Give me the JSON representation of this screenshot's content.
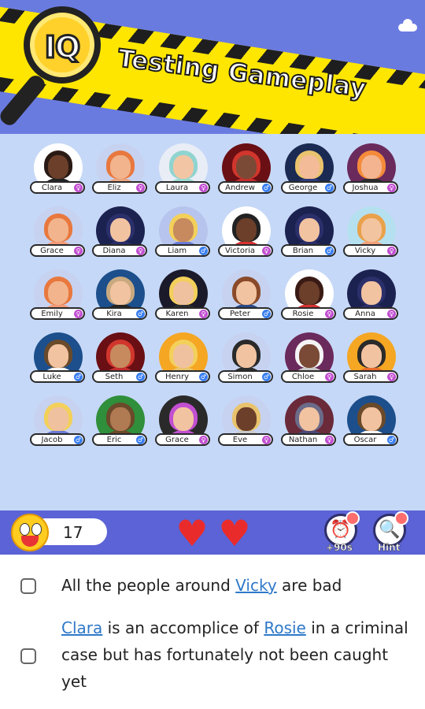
{
  "banner": {
    "logo_text": "IQ",
    "title": "Testing Gameplay"
  },
  "characters": [
    {
      "name": "Clara",
      "gender": "female",
      "hair": "#2a1a14",
      "skin": "#6b3f2a",
      "shirt": "#222",
      "bg": "#ffffff"
    },
    {
      "name": "Eliz",
      "gender": "female",
      "hair": "#e8783e",
      "skin": "#f2b48c",
      "shirt": "#e9a37f",
      "bg": "#c6d2f0"
    },
    {
      "name": "Laura",
      "gender": "female",
      "hair": "#8fd4d0",
      "skin": "#f2c6a4",
      "shirt": "#9ad9d2",
      "bg": "#e9edf5"
    },
    {
      "name": "Andrew",
      "gender": "male",
      "hair": "#d1362c",
      "skin": "#7a4a36",
      "shirt": "#c52e2e",
      "bg": "#6a0f14"
    },
    {
      "name": "George",
      "gender": "male",
      "hair": "#e9c36d",
      "skin": "#f4bb98",
      "shirt": "#2e3a7a",
      "bg": "#1a2a52"
    },
    {
      "name": "Joshua",
      "gender": "female",
      "hair": "#f48b3a",
      "skin": "#f3b48f",
      "shirt": "#2c2c2c",
      "bg": "#6b2a5c"
    },
    {
      "name": "Grace",
      "gender": "female",
      "hair": "#e8783e",
      "skin": "#f2b48c",
      "shirt": "#f39a7a",
      "bg": "#c6d2f0"
    },
    {
      "name": "Diana",
      "gender": "female",
      "hair": "#2b2f6a",
      "skin": "#f2c3a0",
      "shirt": "#2b2f6a",
      "bg": "#1c2250"
    },
    {
      "name": "Liam",
      "gender": "male",
      "hair": "#f3d05a",
      "skin": "#c68a5e",
      "shirt": "#6a7bd6",
      "bg": "#b7c4ee"
    },
    {
      "name": "Victoria",
      "gender": "female",
      "hair": "#222",
      "skin": "#6b3f2a",
      "shirt": "#d83131",
      "bg": "#ffffff"
    },
    {
      "name": "Brian",
      "gender": "male",
      "hair": "#2b2f6a",
      "skin": "#f2c3a0",
      "shirt": "#2b2f6a",
      "bg": "#1c2250"
    },
    {
      "name": "Vicky",
      "gender": "female",
      "hair": "#e9a24b",
      "skin": "#f3c4a0",
      "shirt": "#f3a07a",
      "bg": "#b5e0ef"
    },
    {
      "name": "Emily",
      "gender": "female",
      "hair": "#e8783e",
      "skin": "#f2b48c",
      "shirt": "#f39a7a",
      "bg": "#c6d2f0"
    },
    {
      "name": "Kira",
      "gender": "male",
      "hair": "#c9a97f",
      "skin": "#f2c3a0",
      "shirt": "#222",
      "bg": "#1c4f8c"
    },
    {
      "name": "Karen",
      "gender": "female",
      "hair": "#f3d05a",
      "skin": "#f0c19f",
      "shirt": "#2c2c2c",
      "bg": "#1a1a2a"
    },
    {
      "name": "Peter",
      "gender": "male",
      "hair": "#8a4a2a",
      "skin": "#f2c3a0",
      "shirt": "#2a4a8a",
      "bg": "#c6d2f0"
    },
    {
      "name": "Rosie",
      "gender": "female",
      "hair": "#3a1a14",
      "skin": "#6b3f2a",
      "shirt": "#d83131",
      "bg": "#ffffff"
    },
    {
      "name": "Anna",
      "gender": "female",
      "hair": "#2b2f6a",
      "skin": "#f2c3a0",
      "shirt": "#2b2f6a",
      "bg": "#1c2250"
    },
    {
      "name": "Luke",
      "gender": "male",
      "hair": "#6a4a2a",
      "skin": "#f2c3a0",
      "shirt": "#f4f4f4",
      "bg": "#1c4f8c"
    },
    {
      "name": "Seth",
      "gender": "male",
      "hair": "#d1362c",
      "skin": "#c68a5e",
      "shirt": "#c52e2e",
      "bg": "#6a0f14"
    },
    {
      "name": "Henry",
      "gender": "male",
      "hair": "#f3d05a",
      "skin": "#f0c19f",
      "shirt": "#e9c36d",
      "bg": "#f5a623"
    },
    {
      "name": "Simon",
      "gender": "male",
      "hair": "#2a2a2a",
      "skin": "#f2c3a0",
      "shirt": "#2c2c2c",
      "bg": "#c6d2f0"
    },
    {
      "name": "Chloe",
      "gender": "female",
      "hair": "#f4f4f4",
      "skin": "#7a4a36",
      "shirt": "#c9c9c9",
      "bg": "#6b2a5c"
    },
    {
      "name": "Sarah",
      "gender": "female",
      "hair": "#2a2a2a",
      "skin": "#f2c3a0",
      "shirt": "#e96a2a",
      "bg": "#f5a623"
    },
    {
      "name": "Jacob",
      "gender": "male",
      "hair": "#f3d05a",
      "skin": "#f0c19f",
      "shirt": "#6a7bd6",
      "bg": "#c6d2f0"
    },
    {
      "name": "Eric",
      "gender": "male",
      "hair": "#6a4a2a",
      "skin": "#b07a52",
      "shirt": "#6a4a2a",
      "bg": "#2f8f3a"
    },
    {
      "name": "Grace",
      "gender": "female",
      "hair": "#c24fd1",
      "skin": "#f2c3a0",
      "shirt": "#c24fd1",
      "bg": "#2a2a2a"
    },
    {
      "name": "Eve",
      "gender": "female",
      "hair": "#e9c36d",
      "skin": "#6b3f2a",
      "shirt": "#c9c9c9",
      "bg": "#c6d2f0"
    },
    {
      "name": "Nathan",
      "gender": "female",
      "hair": "#6b6b8a",
      "skin": "#f2c3a0",
      "shirt": "#4a4a7a",
      "bg": "#6a2a3a"
    },
    {
      "name": "Oscar",
      "gender": "male",
      "hair": "#6a4a2a",
      "skin": "#f2c3a0",
      "shirt": "#f4f4f4",
      "bg": "#1c4f8c"
    }
  ],
  "bar": {
    "score": "17",
    "lives": 2,
    "time_label": "+90s",
    "hint_label": "Hint"
  },
  "statements": [
    {
      "parts": [
        {
          "t": "All the people around "
        },
        {
          "t": "Vicky",
          "link": true
        },
        {
          "t": " are bad"
        }
      ]
    },
    {
      "parts": [
        {
          "t": "Clara",
          "link": true
        },
        {
          "t": " is an accomplice of "
        },
        {
          "t": "Rosie",
          "link": true
        },
        {
          "t": " in a criminal case but has fortunately not been caught yet"
        }
      ]
    }
  ],
  "colors": {
    "accent": "#5b63d6",
    "banner_bg": "#6a7be0",
    "tape": "#ffe600",
    "grid_bg": "#c6d8f7",
    "female": "#c24fd1",
    "male": "#3a7ff0",
    "link": "#2f79c9"
  }
}
